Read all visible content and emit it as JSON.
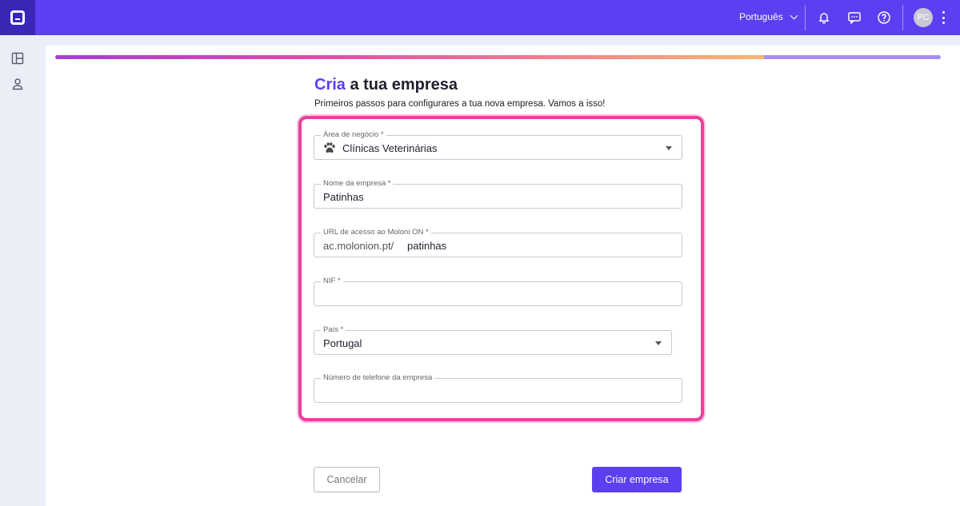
{
  "header": {
    "language": "Português",
    "avatar_initials": "PC"
  },
  "progress": {
    "fraction": 0.8
  },
  "page": {
    "title_accent": "Cria",
    "title_rest": " a tua empresa",
    "subtitle": "Primeiros passos para configurares a tua nova empresa. Vamos a isso!"
  },
  "form": {
    "business_area": {
      "label": "Área de negócio *",
      "value": "Clínicas Veterinárias",
      "icon": "paw-icon"
    },
    "company_name": {
      "label": "Nome da empresa *",
      "value": "Patinhas"
    },
    "access_url": {
      "label": "URL de acesso ao Moloni ON *",
      "prefix": "ac.molonion.pt/",
      "value": "patinhas"
    },
    "nif": {
      "label": "NIF *",
      "value": ""
    },
    "country": {
      "label": "País *",
      "value": "Portugal"
    },
    "phone": {
      "label": "Número de telefone da empresa",
      "value": ""
    }
  },
  "actions": {
    "cancel": "Cancelar",
    "create": "Criar empresa"
  },
  "colors": {
    "brand": "#5b3ff0",
    "highlight": "#e8419c"
  }
}
